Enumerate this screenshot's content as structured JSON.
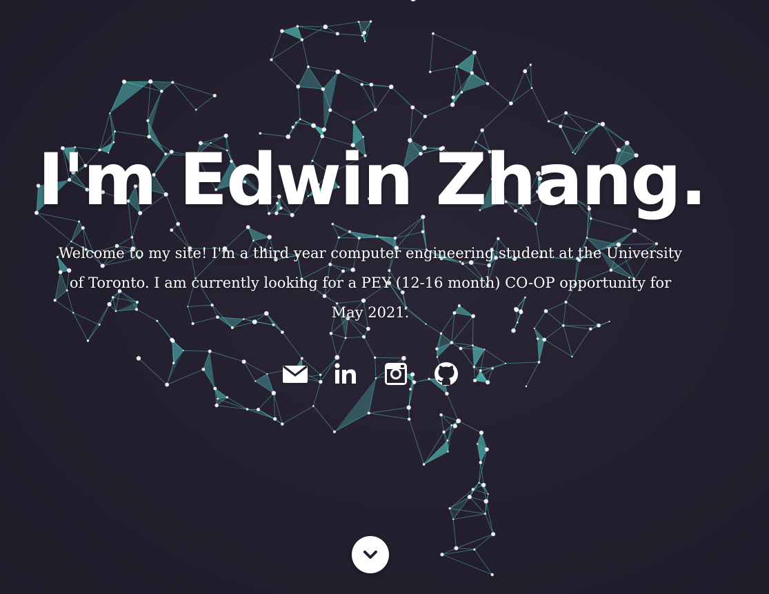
{
  "hero": {
    "headline": "I'm Edwin Zhang.",
    "intro": "Welcome to my site! I'm a third year computer engineering student at the University of Toronto. I am currently looking for a PEY (12-16 month) CO-OP opportunity for May 2021."
  },
  "social": [
    {
      "icon": "envelope-icon",
      "label": "Email"
    },
    {
      "icon": "linkedin-icon",
      "label": "LinkedIn"
    },
    {
      "icon": "instagram-icon",
      "label": "Instagram"
    },
    {
      "icon": "github-icon",
      "label": "GitHub"
    }
  ],
  "scroll": {
    "icon": "chevron-down-icon"
  },
  "colors": {
    "background": "#231f2e",
    "network_accent": "#5ee0d8",
    "text": "#ffffff"
  }
}
